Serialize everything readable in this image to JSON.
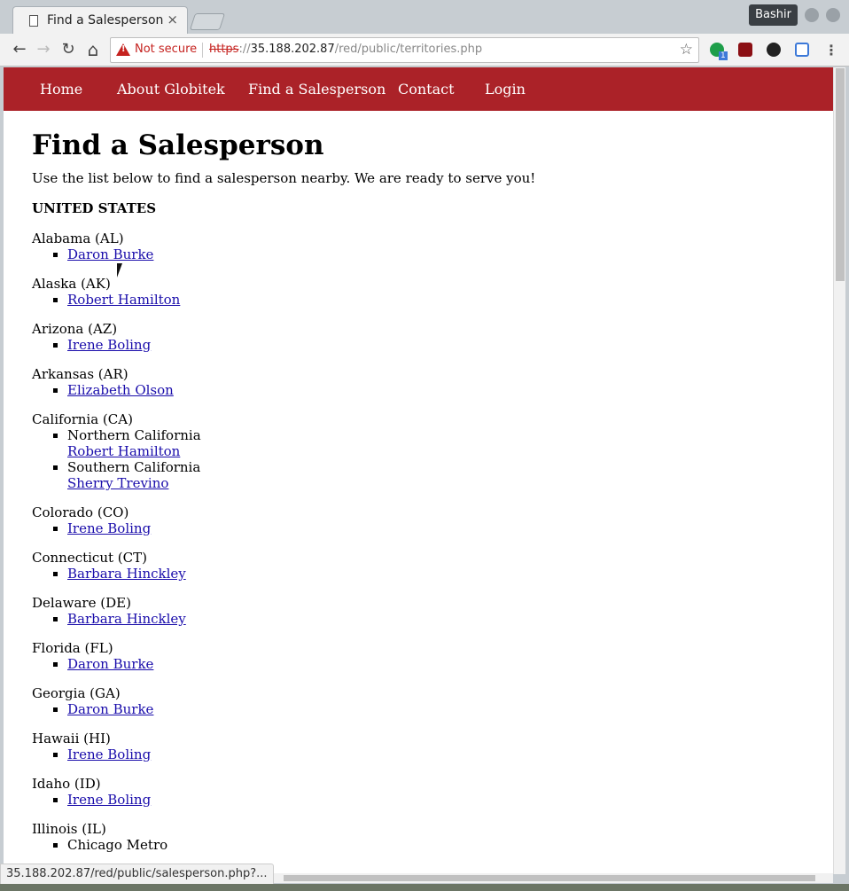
{
  "browser": {
    "tab_title": "Find a Salesperson",
    "tab_close": "×",
    "profile_name": "Bashir",
    "security_label": "Not secure",
    "url_scheme": "https",
    "url_sep": "://",
    "url_host": "35.188.202.87",
    "url_path": "/red/public/territories.php",
    "status_url": "35.188.202.87/red/public/salesperson.php?...",
    "back_icon": "←",
    "forward_icon": "→",
    "reload_icon": "↻",
    "home_icon": "⌂",
    "star_icon": "☆",
    "menu_icon": "⋮",
    "extension_badge": "1"
  },
  "nav": {
    "items": [
      {
        "label": "Home"
      },
      {
        "label": "About Globitek"
      },
      {
        "label": "Find a Salesperson"
      },
      {
        "label": "Contact"
      },
      {
        "label": "Login"
      }
    ]
  },
  "page": {
    "title": "Find a Salesperson",
    "intro": "Use the list below to find a salesperson nearby. We are ready to serve you!",
    "country": "UNITED STATES"
  },
  "states": [
    {
      "name": "Alabama (AL)",
      "entries": [
        {
          "person": "Daron Burke"
        }
      ]
    },
    {
      "name": "Alaska (AK)",
      "entries": [
        {
          "person": "Robert Hamilton"
        }
      ]
    },
    {
      "name": "Arizona (AZ)",
      "entries": [
        {
          "person": "Irene Boling"
        }
      ]
    },
    {
      "name": "Arkansas (AR)",
      "entries": [
        {
          "person": "Elizabeth Olson"
        }
      ]
    },
    {
      "name": "California (CA)",
      "entries": [
        {
          "region": "Northern California",
          "person": "Robert Hamilton"
        },
        {
          "region": "Southern California",
          "person": "Sherry Trevino"
        }
      ]
    },
    {
      "name": "Colorado (CO)",
      "entries": [
        {
          "person": "Irene Boling"
        }
      ]
    },
    {
      "name": "Connecticut (CT)",
      "entries": [
        {
          "person": "Barbara Hinckley"
        }
      ]
    },
    {
      "name": "Delaware (DE)",
      "entries": [
        {
          "person": "Barbara Hinckley"
        }
      ]
    },
    {
      "name": "Florida (FL)",
      "entries": [
        {
          "person": "Daron Burke"
        }
      ]
    },
    {
      "name": "Georgia (GA)",
      "entries": [
        {
          "person": "Daron Burke"
        }
      ]
    },
    {
      "name": "Hawaii (HI)",
      "entries": [
        {
          "person": "Irene Boling"
        }
      ]
    },
    {
      "name": "Idaho (ID)",
      "entries": [
        {
          "person": "Irene Boling"
        }
      ]
    },
    {
      "name": "Illinois (IL)",
      "entries": [
        {
          "region": "Chicago Metro"
        }
      ]
    }
  ],
  "colors": {
    "nav_bg": "#ab2228",
    "link": "#1a0dab",
    "warning": "#c5221f"
  }
}
